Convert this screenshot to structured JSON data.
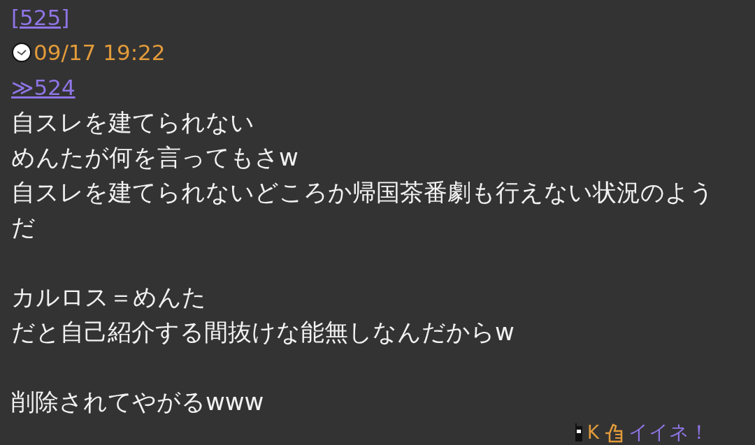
{
  "post": {
    "number": "[525]",
    "time": "09/17 19:22",
    "reply_link": "≫524",
    "paragraphs": [
      [
        "自スレを建てられない",
        "めんたが何を言ってもさw",
        "自スレを建てられないどころか帰国茶番劇も行えない状況のようだ"
      ],
      [
        "カルロス＝めんた",
        "だと自己紹介する間抜けな能無しなんだからw"
      ],
      [
        "削除されてやがるwww"
      ]
    ],
    "author_id": "K",
    "like_label": "イイネ！"
  }
}
